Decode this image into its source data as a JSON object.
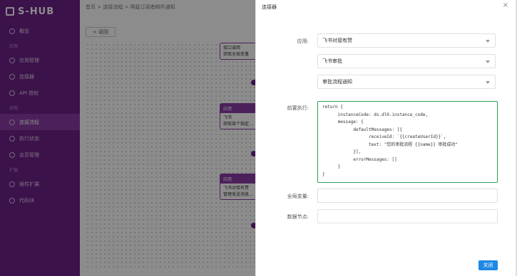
{
  "app": {
    "logo": "S-HUB"
  },
  "sidebar": {
    "items": [
      {
        "label": "概览",
        "group": false
      },
      {
        "label": "应用",
        "group": true
      },
      {
        "label": "应用管理",
        "group": false
      },
      {
        "label": "连接器",
        "group": false
      },
      {
        "label": "API 授权",
        "group": false
      },
      {
        "label": "流程",
        "group": true
      },
      {
        "label": "连接流程",
        "group": false,
        "active": true
      },
      {
        "label": "执行状态",
        "group": false
      },
      {
        "label": "会员管理",
        "group": false
      },
      {
        "label": "扩展",
        "group": true
      },
      {
        "label": "插件扩展",
        "group": false
      },
      {
        "label": "代码块",
        "group": false
      }
    ]
  },
  "main": {
    "breadcrumb": "首页 > 连接流程 > 明星订阅者邮件通知",
    "back_label": "< 返回",
    "nodes": [
      {
        "head": "",
        "body": "接口调用\n获取全局变量"
      },
      {
        "head": "应用",
        "body": "飞书\n获取某个指定…"
      },
      {
        "head": "应用",
        "body": "飞书对接有赞\n管理发送消息…"
      }
    ]
  },
  "drawer": {
    "title": "连接器",
    "close_icon": "×",
    "app_label": "应用:",
    "app_value": "飞书对接有赞",
    "select2_value": "飞书审批",
    "select3_value": "审批流程通知",
    "pre_exec_label": "前置执行:",
    "code": "return {\n      instanceCode: ds.dl0.instance_code,\n      message: {\n            defaultMessages: [{\n                  receiveId: `{{createUserId}}`,\n                  text: \"您的审批流程 {{name}} 审批成功\"\n            }],\n            errorMessages: []\n      }\n}",
    "global_var_label": "全局变量:",
    "data_node_label": "数据节点:",
    "close_button": "关闭"
  },
  "colors": {
    "sidebar": "#6e2189",
    "accent": "#1e88e5",
    "focus": "#2f9e57"
  }
}
